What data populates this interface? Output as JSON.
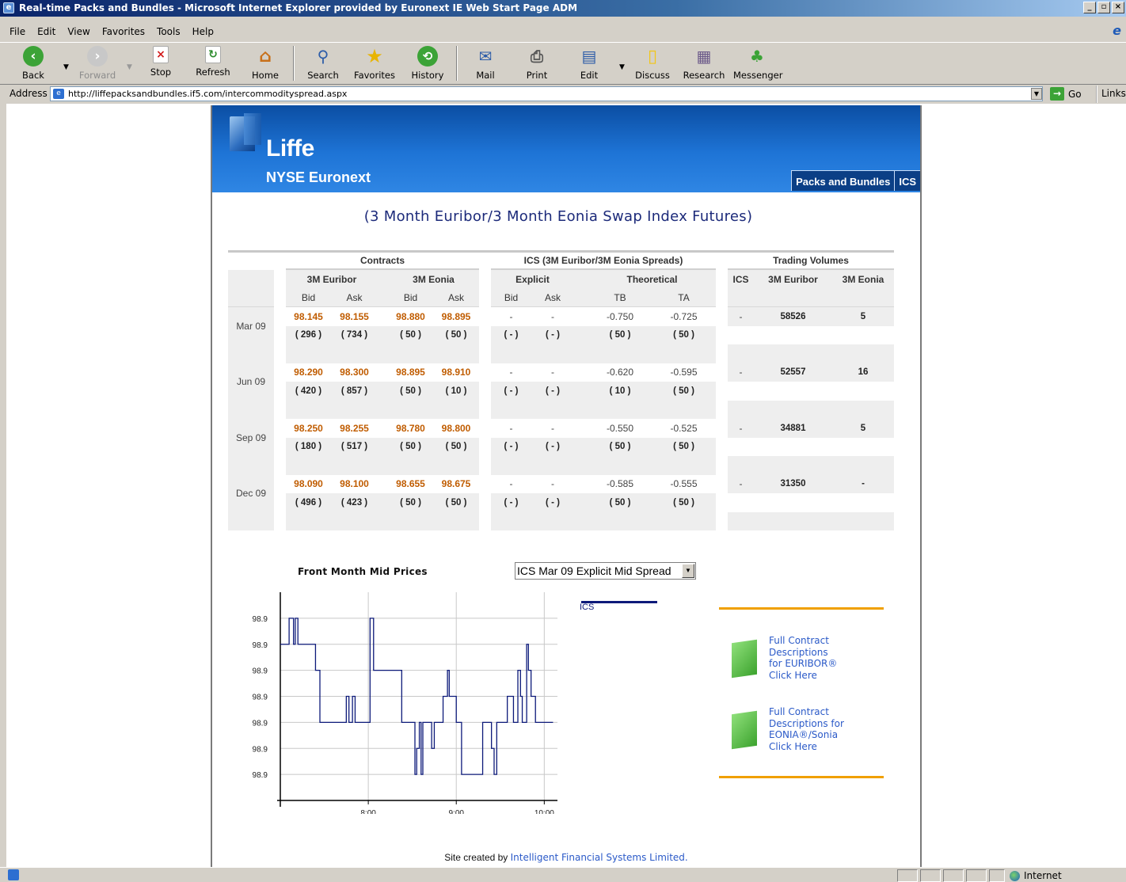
{
  "window": {
    "title": "Real-time Packs and Bundles - Microsoft Internet Explorer provided by Euronext IE Web Start Page ADM"
  },
  "menu": [
    "File",
    "Edit",
    "View",
    "Favorites",
    "Tools",
    "Help"
  ],
  "toolbar": {
    "back": "Back",
    "forward": "Forward",
    "stop": "Stop",
    "refresh": "Refresh",
    "home": "Home",
    "search": "Search",
    "favorites": "Favorites",
    "history": "History",
    "mail": "Mail",
    "print": "Print",
    "edit": "Edit",
    "discuss": "Discuss",
    "research": "Research",
    "messenger": "Messenger"
  },
  "address": {
    "label": "Address",
    "url": "http://liffepacksandbundles.if5.com/intercommodityspread.aspx",
    "go": "Go",
    "links": "Links"
  },
  "site": {
    "logo": "Liffe",
    "logo_sub": "NYSE Euronext",
    "nav": [
      "Packs and Bundles",
      "ICS"
    ],
    "title": "(3 Month Euribor/3 Month Eonia Swap Index Futures)"
  },
  "table": {
    "groups": {
      "contracts": "Contracts",
      "ics": "ICS (3M Euribor/3M Eonia Spreads)",
      "volumes": "Trading Volumes"
    },
    "sub": {
      "euribor": "3M Euribor",
      "eonia": "3M Eonia",
      "explicit": "Explicit",
      "theoretical": "Theoretical",
      "ics": "ICS",
      "vol_euribor": "3M Euribor",
      "vol_eonia": "3M Eonia"
    },
    "cols": {
      "bid": "Bid",
      "ask": "Ask",
      "tb": "TB",
      "ta": "TA"
    },
    "rows": [
      {
        "month": "Mar 09",
        "prices": [
          "98.145",
          "98.155",
          "98.880",
          "98.895"
        ],
        "qty": [
          "( 296 )",
          "( 734 )",
          "( 50 )",
          "( 50 )"
        ],
        "explicit": [
          "-",
          "-"
        ],
        "explicit_qty": [
          "( - )",
          "( - )"
        ],
        "theo": [
          "-0.750",
          "-0.725"
        ],
        "theo_qty": [
          "( 50 )",
          "( 50 )"
        ],
        "vol": [
          "-",
          "58526",
          "5"
        ]
      },
      {
        "month": "Jun 09",
        "prices": [
          "98.290",
          "98.300",
          "98.895",
          "98.910"
        ],
        "qty": [
          "( 420 )",
          "( 857 )",
          "( 50 )",
          "( 10 )"
        ],
        "explicit": [
          "-",
          "-"
        ],
        "explicit_qty": [
          "( - )",
          "( - )"
        ],
        "theo": [
          "-0.620",
          "-0.595"
        ],
        "theo_qty": [
          "( 10 )",
          "( 50 )"
        ],
        "vol": [
          "-",
          "52557",
          "16"
        ]
      },
      {
        "month": "Sep 09",
        "prices": [
          "98.250",
          "98.255",
          "98.780",
          "98.800"
        ],
        "qty": [
          "( 180 )",
          "( 517 )",
          "( 50 )",
          "( 50 )"
        ],
        "explicit": [
          "-",
          "-"
        ],
        "explicit_qty": [
          "( - )",
          "( - )"
        ],
        "theo": [
          "-0.550",
          "-0.525"
        ],
        "theo_qty": [
          "( 50 )",
          "( 50 )"
        ],
        "vol": [
          "-",
          "34881",
          "5"
        ]
      },
      {
        "month": "Dec 09",
        "prices": [
          "98.090",
          "98.100",
          "98.655",
          "98.675"
        ],
        "qty": [
          "( 496 )",
          "( 423 )",
          "( 50 )",
          "( 50 )"
        ],
        "explicit": [
          "-",
          "-"
        ],
        "explicit_qty": [
          "( - )",
          "( - )"
        ],
        "theo": [
          "-0.585",
          "-0.555"
        ],
        "theo_qty": [
          "( 50 )",
          "( 50 )"
        ],
        "vol": [
          "-",
          "31350",
          "-"
        ]
      }
    ]
  },
  "chart": {
    "heading": "Front Month Mid Prices",
    "selected": "ICS Mar 09 Explicit Mid Spread",
    "legend": "ICS",
    "color": "#0d1a7a"
  },
  "chart_data": {
    "type": "line",
    "yticks": [
      "98.9",
      "98.9",
      "98.9",
      "98.9",
      "98.9",
      "98.9",
      "98.9"
    ],
    "xticks": [
      "8:00",
      "9:00",
      "10:00"
    ],
    "series": [
      {
        "name": "ICS",
        "x": [
          7.0,
          7.08,
          7.1,
          7.12,
          7.15,
          7.17,
          7.2,
          7.25,
          7.3,
          7.35,
          7.4,
          7.45,
          7.5,
          7.55,
          7.62,
          7.7,
          7.75,
          7.78,
          7.82,
          7.85,
          7.88,
          7.95,
          8.0,
          8.02,
          8.06,
          8.1,
          8.15,
          8.2,
          8.3,
          8.38,
          8.42,
          8.47,
          8.5,
          8.53,
          8.55,
          8.58,
          8.6,
          8.62,
          8.67,
          8.72,
          8.75,
          8.8,
          8.85,
          8.9,
          8.92,
          9.0,
          9.02,
          9.06,
          9.1,
          9.15,
          9.2,
          9.25,
          9.3,
          9.35,
          9.4,
          9.43,
          9.46,
          9.5,
          9.52,
          9.55,
          9.58,
          9.62,
          9.65,
          9.7,
          9.73,
          9.75,
          9.8,
          9.82,
          9.85,
          9.9,
          9.95,
          10.0,
          10.05,
          10.1
        ],
        "y": [
          6,
          6,
          7,
          7,
          6,
          7,
          6,
          6,
          6,
          6,
          5,
          3,
          3,
          3,
          3,
          3,
          4,
          3,
          4,
          3,
          3,
          3,
          3,
          7,
          5,
          5,
          5,
          5,
          5,
          3,
          3,
          3,
          3,
          1,
          2,
          3,
          1,
          3,
          3,
          2,
          3,
          3,
          4,
          5,
          4,
          3,
          3,
          1,
          1,
          1,
          1,
          1,
          3,
          3,
          2,
          1,
          3,
          3,
          3,
          3,
          4,
          4,
          3,
          5,
          4,
          3,
          6,
          5,
          4,
          3,
          3,
          3,
          3,
          3
        ]
      }
    ],
    "ylim": [
      0,
      8
    ],
    "xlim": [
      7,
      10.15
    ],
    "grid": true,
    "legend": "top-right"
  },
  "sidebar": {
    "euribor_link": [
      "Full Contract",
      "Descriptions",
      "for EURIBOR®",
      "Click Here"
    ],
    "eonia_link": [
      "Full Contract",
      "Descriptions for",
      "EONIA®/Sonia",
      "Click Here"
    ]
  },
  "footer": {
    "prefix": "Site created by ",
    "link": "Intelligent Financial Systems Limited."
  },
  "status": {
    "zone": "Internet"
  }
}
